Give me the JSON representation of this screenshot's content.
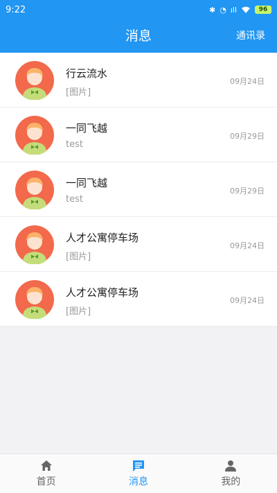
{
  "status_bar": {
    "time": "9:22",
    "battery": "96",
    "signal": "ıll"
  },
  "header": {
    "title": "消息",
    "action": "通讯录"
  },
  "colors": {
    "primary": "#2196F3"
  },
  "conversations": [
    {
      "name": "行云流水",
      "preview": "[图片]",
      "time": "09月24日"
    },
    {
      "name": "一同飞越",
      "preview": "test",
      "time": "09月29日"
    },
    {
      "name": "一同飞越",
      "preview": "test",
      "time": "09月29日"
    },
    {
      "name": "人才公寓停车场",
      "preview": "[图片]",
      "time": "09月24日"
    },
    {
      "name": "人才公寓停车场",
      "preview": "[图片]",
      "time": "09月24日"
    }
  ],
  "tabs": [
    {
      "label": "首页",
      "icon": "home-icon"
    },
    {
      "label": "消息",
      "icon": "message-icon",
      "active": true
    },
    {
      "label": "我的",
      "icon": "person-icon"
    }
  ]
}
